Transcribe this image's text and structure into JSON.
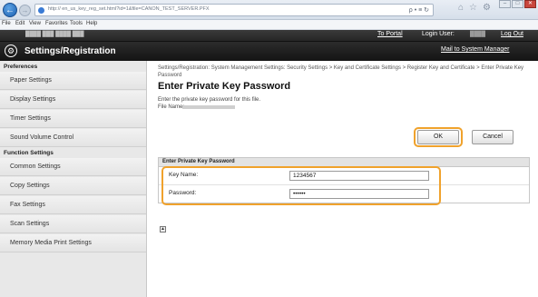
{
  "browser": {
    "url": "http://  en_us_key_reg_set.html?id=1&file=CANON_TEST_SERVER.PFX",
    "address_tools": "ρ • ≡ ↻",
    "menu": [
      "File",
      "Edit",
      "View",
      "Favorites",
      "Tools",
      "Help"
    ]
  },
  "header": {
    "to_portal": "To Portal",
    "login_user_label": "Login User:",
    "logout": "Log Out",
    "app_title": "Settings/Registration",
    "mail_link": "Mail to System Manager"
  },
  "sidebar": {
    "preferences_heading": "Preferences",
    "preferences_items": [
      "Paper Settings",
      "Display Settings",
      "Timer Settings",
      "Sound Volume Control"
    ],
    "function_heading": "Function Settings",
    "function_items": [
      "Common Settings",
      "Copy Settings",
      "Fax Settings",
      "Scan Settings",
      "Memory Media Print Settings"
    ]
  },
  "main": {
    "breadcrumb": "Settings/Registration: System Management Settings: Security Settings > Key and Certificate Settings > Register Key and Certificate > Enter Private Key Password",
    "title": "Enter Private Key Password",
    "instruction": "Enter the private key password for this file.",
    "file_name_label": "File Name:",
    "ok_label": "OK",
    "cancel_label": "Cancel",
    "section_title": "Enter Private Key Password",
    "key_name_label": "Key Name:",
    "key_name_value": "1234567",
    "password_label": "Password:",
    "password_value": "••••••",
    "top_icon": "▲"
  }
}
